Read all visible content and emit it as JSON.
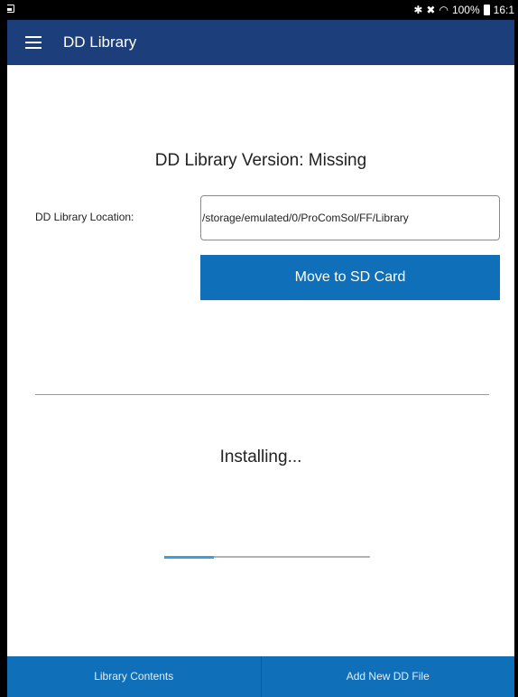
{
  "status_bar": {
    "icons": [
      "gallery-icon",
      "bluetooth-icon",
      "mute-icon",
      "wifi-icon",
      "battery-icon"
    ],
    "battery": "100%",
    "time": "16:1"
  },
  "app_bar": {
    "title": "DD Library",
    "background": "#1c3f7b"
  },
  "library": {
    "version_heading": "DD Library Version: Missing",
    "location_label": "DD Library Location:",
    "location_value": "/storage/emulated/0/ProComSol/FF/Library",
    "move_button_label": "Move to SD Card"
  },
  "install": {
    "status_text": "Installing...",
    "progress": 0.24
  },
  "bottom_bar": {
    "left_label": "Library Contents",
    "right_label": "Add New DD File",
    "background": "#0f6fb8"
  }
}
